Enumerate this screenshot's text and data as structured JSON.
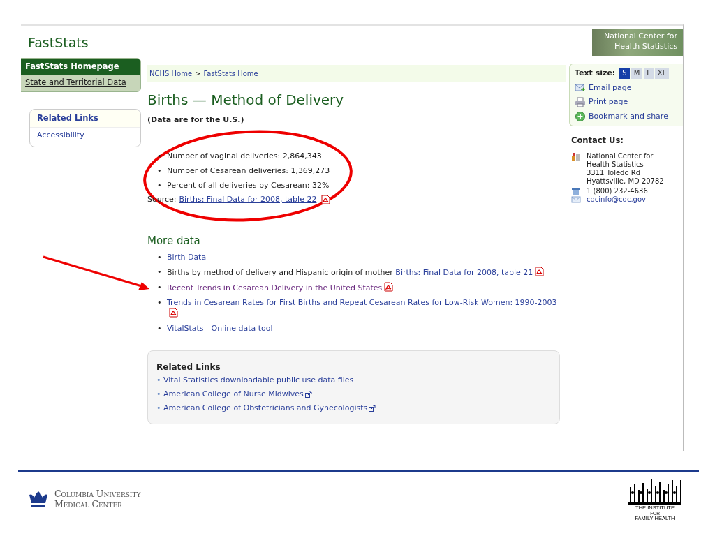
{
  "site_title": "FastStats",
  "logo_lines": [
    "National Center for",
    "Health Statistics"
  ],
  "left_nav": [
    {
      "label": "FastStats Homepage",
      "selected": true
    },
    {
      "label": "State and Territorial Data",
      "selected": false
    }
  ],
  "side_links": {
    "title": "Related Links",
    "items": [
      "Accessibility"
    ]
  },
  "breadcrumb": {
    "items": [
      "NCHS Home",
      "FastStats Home"
    ],
    "separator": ">"
  },
  "page_title": "Births — Method of Delivery",
  "subtitle": "(Data are for the U.S.)",
  "bullet": "•",
  "facts": [
    "Number of vaginal deliveries: 2,864,343",
    "Number of Cesarean deliveries: 1,369,273",
    "Percent of all deliveries by Cesarean: 32%"
  ],
  "source": {
    "label": "Source:",
    "link": "Births: Final Data for 2008, table 22",
    "pdf": true
  },
  "more_data": {
    "heading": "More data",
    "items": [
      {
        "link": "Birth Data",
        "pdf": false,
        "visited": false
      },
      {
        "text": "Births by method of delivery and Hispanic origin of mother",
        "link": "Births: Final Data for 2008, table 21",
        "pdf": true,
        "visited": false
      },
      {
        "link": "Recent Trends in Cesarean Delivery in the United States",
        "pdf": true,
        "visited": true
      },
      {
        "link": "Trends in Cesarean Rates for First Births and Repeat Cesarean Rates for Low-Risk Women: 1990-2003",
        "pdf": true,
        "visited": false
      },
      {
        "link": "VitalStats - Online data tool",
        "pdf": false,
        "visited": false
      }
    ]
  },
  "related_links": {
    "title": "Related Links",
    "items": [
      {
        "label": "Vital Statistics downloadable public use data files",
        "external": false
      },
      {
        "label": "American College of Nurse Midwives",
        "external": true
      },
      {
        "label": "American College of Obstetricians and Gynecologists",
        "external": true
      }
    ]
  },
  "text_size": {
    "label": "Text size:",
    "options": [
      {
        "label": "S",
        "selected": true
      },
      {
        "label": "M",
        "selected": false
      },
      {
        "label": "L",
        "selected": false
      },
      {
        "label": "XL",
        "selected": false
      }
    ]
  },
  "tools": [
    {
      "kind": "email",
      "label": "Email page"
    },
    {
      "kind": "print",
      "label": "Print page"
    },
    {
      "kind": "bookmark",
      "label": "Bookmark and share"
    }
  ],
  "contact": {
    "title": "Contact Us:",
    "address": [
      "National Center for",
      "Health Statistics",
      "3311 Toledo Rd",
      "Hyattsville, MD 20782"
    ],
    "phone": "1 (800) 232-4636",
    "email": "cdcinfo@cdc.gov"
  },
  "footer": {
    "left_lines": [
      "Columbia University",
      "Medical Center"
    ],
    "right_lines": [
      "THE INSTITUTE",
      "FOR",
      "FAMILY HEALTH"
    ]
  }
}
